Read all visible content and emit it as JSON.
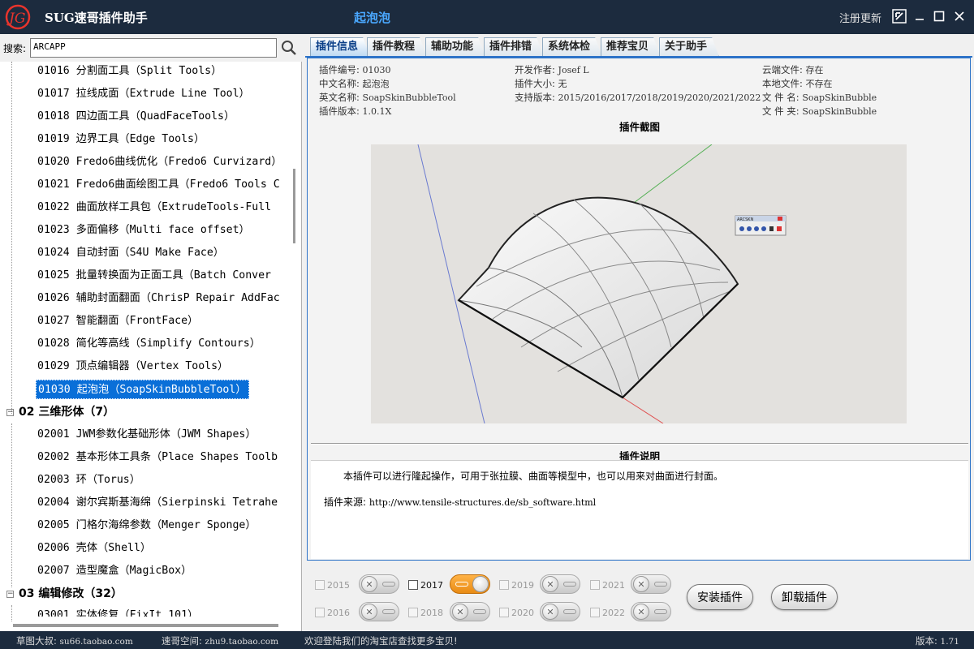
{
  "app": {
    "title": "SUG速哥插件助手",
    "window_title": "起泡泡",
    "register_label": "注册更新",
    "accent_color": "#2d73c8"
  },
  "search": {
    "label": "搜索:",
    "value": "ARCAPP"
  },
  "tree": {
    "items": [
      {
        "code": "01016",
        "label": "01016 分割面工具（Split Tools）"
      },
      {
        "code": "01017",
        "label": "01017 拉线成面（Extrude Line Tool）"
      },
      {
        "code": "01018",
        "label": "01018 四边面工具（QuadFaceTools）"
      },
      {
        "code": "01019",
        "label": "01019 边界工具（Edge Tools）"
      },
      {
        "code": "01020",
        "label": "01020 Fredo6曲线优化（Fredo6 Curvizard）"
      },
      {
        "code": "01021",
        "label": "01021 Fredo6曲面绘图工具（Fredo6 Tools C"
      },
      {
        "code": "01022",
        "label": "01022 曲面放样工具包（ExtrudeTools-Full"
      },
      {
        "code": "01023",
        "label": "01023 多面偏移（Multi face offset）"
      },
      {
        "code": "01024",
        "label": "01024 自动封面（S4U Make Face）"
      },
      {
        "code": "01025",
        "label": "01025 批量转换面为正面工具（Batch Conver"
      },
      {
        "code": "01026",
        "label": "01026 辅助封面翻面（ChrisP Repair AddFac"
      },
      {
        "code": "01027",
        "label": "01027 智能翻面（FrontFace）"
      },
      {
        "code": "01028",
        "label": "01028 简化等高线（Simplify Contours）"
      },
      {
        "code": "01029",
        "label": "01029 顶点编辑器（Vertex Tools）"
      },
      {
        "code": "01030",
        "label": "01030 起泡泡（SoapSkinBubbleTool）"
      }
    ],
    "category_02": {
      "label": "02 三维形体（7）",
      "expander": "−"
    },
    "items_02": [
      {
        "label": "02001 JWM参数化基础形体（JWM Shapes）"
      },
      {
        "label": "02002 基本形体工具条（Place Shapes Toolb"
      },
      {
        "label": "02003 环（Torus）"
      },
      {
        "label": "02004 谢尔宾斯基海绵（Sierpinski Tetrahe"
      },
      {
        "label": "02005 门格尔海绵参数（Menger Sponge）"
      },
      {
        "label": "02006 壳体（Shell）"
      },
      {
        "label": "02007 造型魔盒（MagicBox）"
      }
    ],
    "category_03": {
      "label": "03 编辑修改（32）",
      "expander": "−"
    },
    "partial_item": "03001 实体修复（FixIt 101）"
  },
  "tabs": [
    {
      "label": "插件信息",
      "active": true
    },
    {
      "label": "插件教程",
      "active": false
    },
    {
      "label": "辅助功能",
      "active": false
    },
    {
      "label": "插件排错",
      "active": false
    },
    {
      "label": "系统体检",
      "active": false
    },
    {
      "label": "推荐宝贝",
      "active": false
    },
    {
      "label": "关于助手",
      "active": false
    }
  ],
  "info": {
    "code_label": "插件编号:",
    "code": "01030",
    "cn_name_label": "中文名称:",
    "cn_name": "起泡泡",
    "en_name_label": "英文名称:",
    "en_name": "SoapSkinBubbleTool",
    "version_label": "插件版本:",
    "version": "1.0.1X",
    "author_label": "开发作者:",
    "author": "Josef L",
    "size_label": "插件大小:",
    "size": "无",
    "support_label": "支持版本:",
    "support": "2015/2016/2017/2018/2019/2020/2021/2022",
    "cloud_label": "云端文件:",
    "cloud": "存在",
    "local_label": "本地文件:",
    "local": "不存在",
    "filename_label": "文 件 名:",
    "filename": "SoapSkinBubble",
    "folder_label": "文 件 夹:",
    "folder": "SoapSkinBubble"
  },
  "screenshot_title": "插件截图",
  "screenshot_toolbar_title": "ARCSKN",
  "description": {
    "title": "插件说明",
    "text": "本插件可以进行隆起操作，可用于张拉膜、曲面等模型中，也可以用来对曲面进行封面。",
    "source_label": "插件来源:",
    "source_url": "http://www.tensile-structures.de/sb_software.html"
  },
  "versions": [
    {
      "year": "2015",
      "enabled": false
    },
    {
      "year": "2016",
      "enabled": false
    },
    {
      "year": "2017",
      "enabled": true
    },
    {
      "year": "2018",
      "enabled": false
    },
    {
      "year": "2019",
      "enabled": false
    },
    {
      "year": "2020",
      "enabled": false
    },
    {
      "year": "2021",
      "enabled": false
    },
    {
      "year": "2022",
      "enabled": false
    }
  ],
  "buttons": {
    "install": "安装插件",
    "uninstall": "卸载插件"
  },
  "status": {
    "left_label": "草图大叔:",
    "left_url": "su66.taobao.com",
    "mid_label": "速哥空间:",
    "mid_url": "zhu9.taobao.com",
    "message": "欢迎登陆我们的淘宝店查找更多宝贝!",
    "version_label": "版本:",
    "version": "1.71"
  }
}
